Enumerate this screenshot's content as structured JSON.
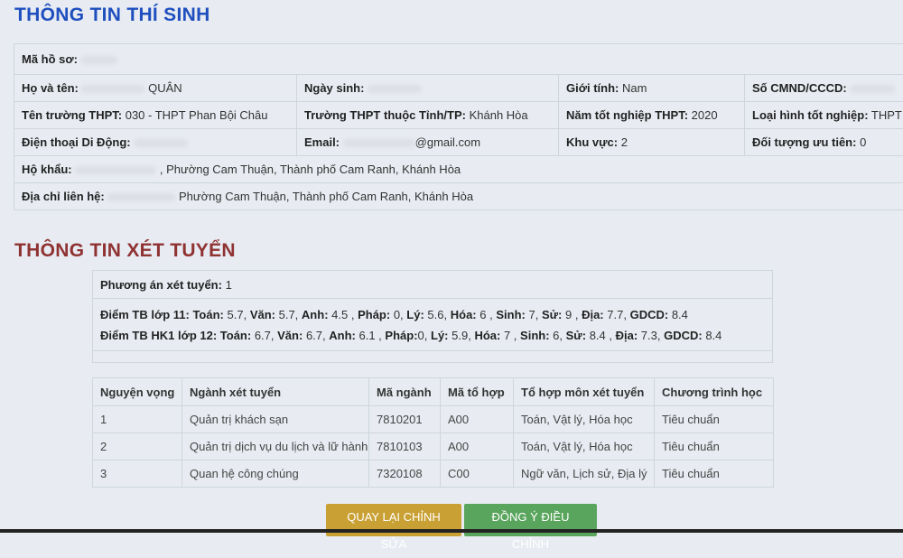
{
  "candidate": {
    "title": "THÔNG TIN THÍ SINH",
    "ma_ho_so": {
      "label": "Mã hồ sơ:"
    },
    "ho_ten": {
      "label": "Họ và tên:",
      "value": "QUÂN"
    },
    "ngay_sinh": {
      "label": "Ngày sinh:"
    },
    "gioi_tinh": {
      "label": "Giới tính:",
      "value": "Nam"
    },
    "cmnd": {
      "label": "Số CMND/CCCD:"
    },
    "truong": {
      "label": "Tên trường THPT:",
      "value": "030 - THPT Phan Bội Châu"
    },
    "tinh": {
      "label": "Trường THPT thuộc Tỉnh/TP:",
      "value": "Khánh Hòa"
    },
    "nam_tn": {
      "label": "Năm tốt nghiệp THPT:",
      "value": "2020"
    },
    "loai_hinh": {
      "label": "Loại hình tốt nghiệp:",
      "value": "THPT"
    },
    "dien_thoai": {
      "label": "Điện thoại Di Động:"
    },
    "email": {
      "label": "Email:",
      "value": "@gmail.com"
    },
    "khu_vuc": {
      "label": "Khu vực:",
      "value": "2"
    },
    "doi_tuong": {
      "label": "Đối tượng ưu tiên:",
      "value": "0"
    },
    "ho_khau": {
      "label": "Hộ khẩu:",
      "value": ", Phường Cam Thuận, Thành phố Cam Ranh, Khánh Hòa"
    },
    "dia_chi": {
      "label": "Địa chỉ liên hệ:",
      "value": "Phường Cam Thuận, Thành phố Cam Ranh, Khánh Hòa"
    }
  },
  "admission": {
    "title": "THÔNG TIN XÉT TUYỂN",
    "phuong_an": {
      "label": "Phương án xét tuyển:",
      "value": "1"
    },
    "lop11": {
      "label": "Điểm TB lớp 11:",
      "toan_l": "Toán:",
      "toan": "5.7,",
      "van_l": "Văn:",
      "van": "5.7,",
      "anh_l": "Anh:",
      "anh": "4.5 ,",
      "phap_l": "Pháp:",
      "phap": "0,",
      "ly_l": "Lý:",
      "ly": "5.6,",
      "hoa_l": "Hóa:",
      "hoa": "6 ,",
      "sinh_l": "Sinh:",
      "sinh": "7,",
      "su_l": "Sử:",
      "su": "9 ,",
      "dia_l": "Địa:",
      "dia": "7.7,",
      "gdcd_l": "GDCD:",
      "gdcd": "8.4"
    },
    "hk1_12": {
      "label": "Điểm TB HK1 lớp 12:",
      "toan_l": "Toán:",
      "toan": "6.7,",
      "van_l": "Văn:",
      "van": "6.7,",
      "anh_l": "Anh:",
      "anh": "6.1 ,",
      "phap_l": "Pháp:",
      "phap": "0,",
      "ly_l": "Lý:",
      "ly": "5.9,",
      "hoa_l": "Hóa:",
      "hoa": "7 ,",
      "sinh_l": "Sinh:",
      "sinh": "6,",
      "su_l": "Sử:",
      "su": "8.4 ,",
      "dia_l": "Địa:",
      "dia": "7.3,",
      "gdcd_l": "GDCD:",
      "gdcd": "8.4"
    },
    "columns": [
      "Nguyện vọng",
      "Ngành xét tuyển",
      "Mã ngành",
      "Mã tổ hợp",
      "Tổ hợp môn xét tuyển",
      "Chương trình học"
    ],
    "rows": [
      [
        "1",
        "Quản trị khách sạn",
        "7810201",
        "A00",
        "Toán, Vật lý, Hóa học",
        "Tiêu chuẩn"
      ],
      [
        "2",
        "Quản trị dịch vụ du lịch và lữ hành",
        "7810103",
        "A00",
        "Toán, Vật lý, Hóa học",
        "Tiêu chuẩn"
      ],
      [
        "3",
        "Quan hệ công chúng",
        "7320108",
        "C00",
        "Ngữ văn, Lịch sử, Địa lý",
        "Tiêu chuẩn"
      ]
    ]
  },
  "buttons": {
    "back": "QUAY LẠI CHỈNH SỬA",
    "confirm": "ĐỒNG Ý ĐIỀU CHỈNH"
  }
}
